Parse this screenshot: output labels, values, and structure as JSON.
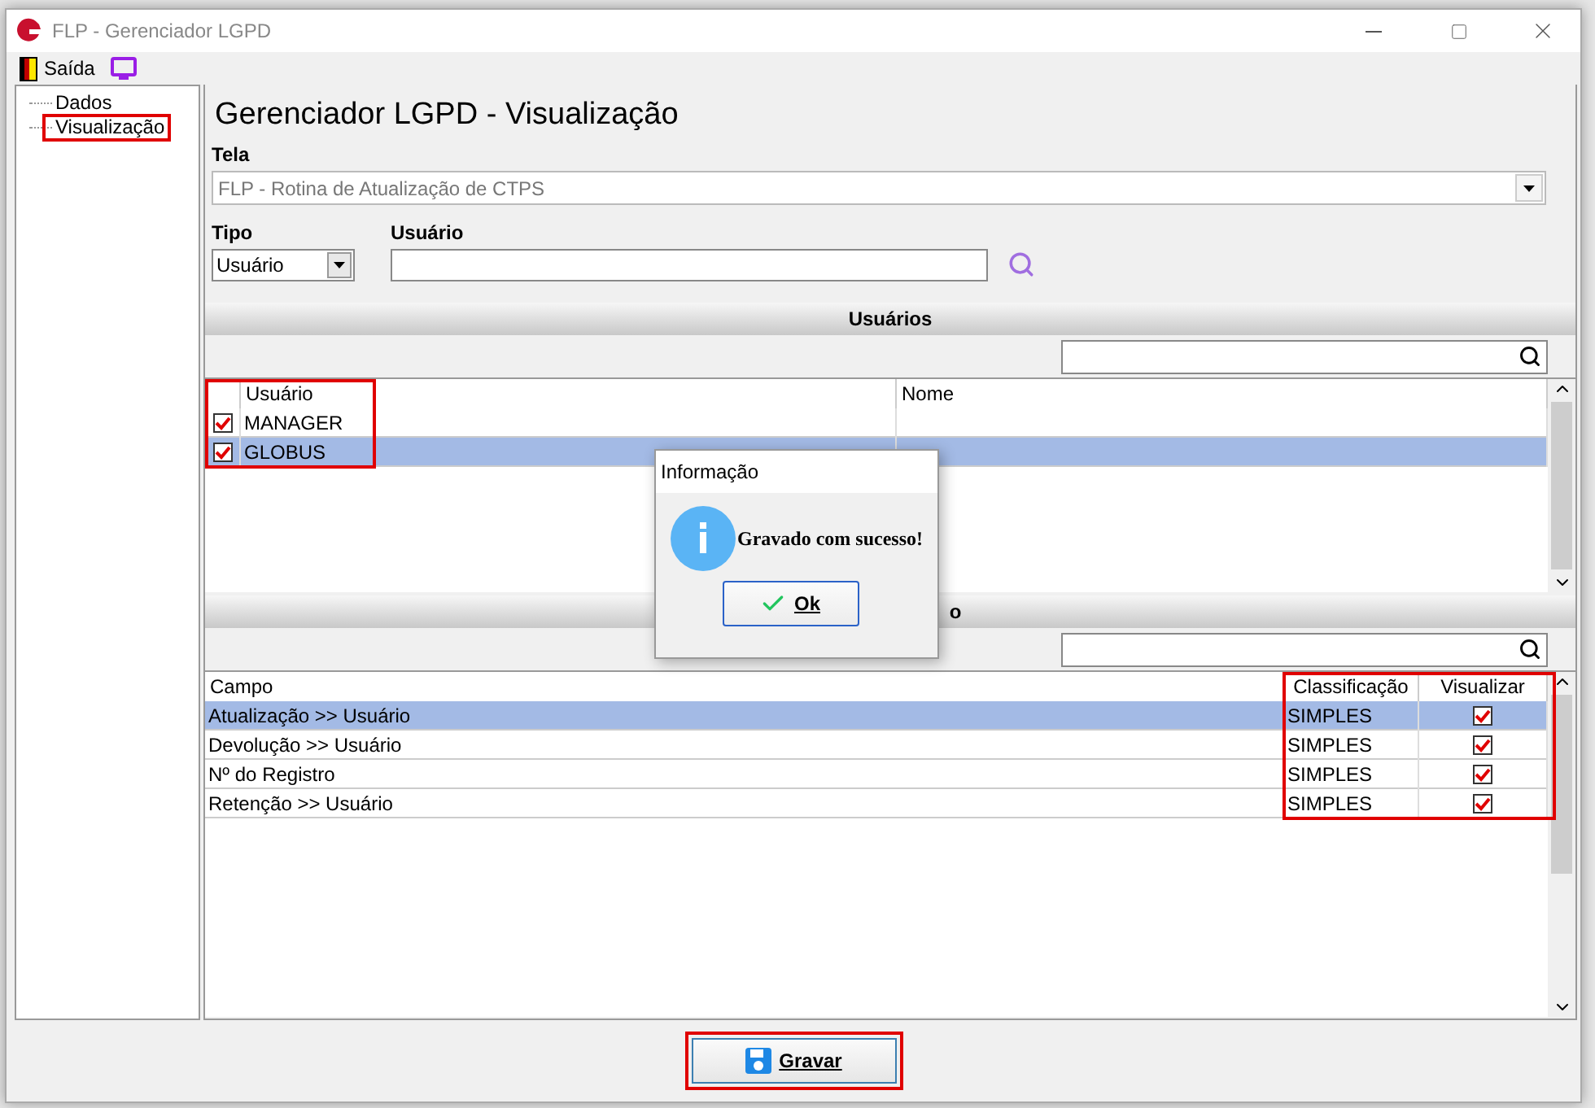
{
  "window": {
    "title": "FLP - Gerenciador LGPD"
  },
  "menu": [
    {
      "label": "Saída",
      "kind": "exit"
    },
    {
      "kind": "monitor"
    }
  ],
  "tree": [
    {
      "label": "Dados",
      "highlighted": false
    },
    {
      "label": "Visualização",
      "highlighted": true
    }
  ],
  "heading": "Gerenciador LGPD - Visualização",
  "tela": {
    "label": "Tela",
    "value": "FLP - Rotina de Atualização de CTPS",
    "disabled": true
  },
  "tipo": {
    "label": "Tipo",
    "value": "Usuário"
  },
  "usuario_field": {
    "label": "Usuário"
  },
  "users_section": {
    "title": "Usuários",
    "columns": [
      {
        "highlighted": true
      },
      {
        "label": "Usuário",
        "highlighted": true
      },
      {
        "label": "Nome",
        "highlighted": false
      }
    ],
    "rows": [
      {
        "checked": true,
        "usuario": "MANAGER",
        "selected": false
      },
      {
        "checked": true,
        "usuario": "GLOBUS",
        "selected": true
      }
    ]
  },
  "fields_section": {
    "title": "o",
    "columns": [
      {
        "label": "Campo",
        "highlighted": false
      },
      {
        "label": "Classificação",
        "highlighted": true
      },
      {
        "label": "Visualizar",
        "highlighted": true
      }
    ],
    "rows": [
      {
        "campo": "Atualização >> Usuário",
        "classificacao": "SIMPLES",
        "checked": true,
        "selected": true
      },
      {
        "campo": "Devolução >> Usuário",
        "classificacao": "SIMPLES",
        "checked": true,
        "selected": false
      },
      {
        "campo": "Nº do Registro",
        "classificacao": "SIMPLES",
        "checked": true,
        "selected": false
      },
      {
        "campo": "Retenção >> Usuário",
        "classificacao": "SIMPLES",
        "checked": true,
        "selected": false
      }
    ]
  },
  "save_button": {
    "label": "Gravar",
    "highlighted": true
  },
  "dialog": {
    "title": "Informação",
    "message": "Gravado com sucesso!",
    "button": "Ok"
  }
}
